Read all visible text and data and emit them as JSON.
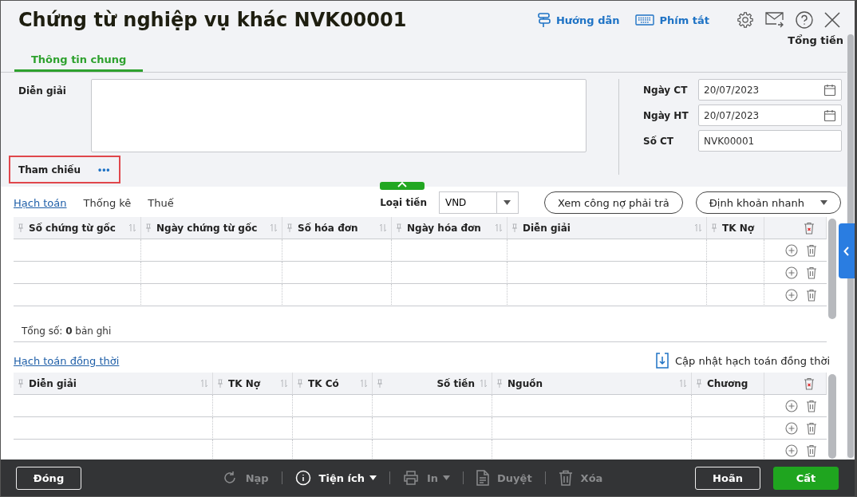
{
  "window": {
    "title": "Chứng từ nghiệp vụ khác NVK00001"
  },
  "header_links": [
    {
      "label": "Hướng dẫn"
    },
    {
      "label": "Phím tắt"
    }
  ],
  "total_label": "Tổng tiền",
  "tabs": [
    {
      "label": "Thông tin chung",
      "selected": true
    }
  ],
  "form": {
    "description_label": "Diễn giải",
    "reference_label": "Tham chiếu",
    "reference_button": "•••",
    "fields": [
      {
        "label": "Ngày CT",
        "value": "20/07/2023",
        "kind": "date"
      },
      {
        "label": "Ngày HT",
        "value": "20/07/2023",
        "kind": "date"
      },
      {
        "label": "Số CT",
        "value": "NVK00001",
        "kind": "text"
      }
    ]
  },
  "detail_tabs": [
    {
      "label": "Hạch toán",
      "selected": true
    },
    {
      "label": "Thống kê",
      "selected": false
    },
    {
      "label": "Thuế",
      "selected": false
    }
  ],
  "currency": {
    "label": "Loại tiền",
    "value": "VND"
  },
  "detail_buttons": [
    {
      "label": "Xem công nợ phải trả",
      "kind": "plain"
    },
    {
      "label": "Định khoản nhanh",
      "kind": "dropdown"
    }
  ],
  "table": {
    "columns": [
      {
        "label": "Số chứng từ gốc",
        "kind": "text"
      },
      {
        "label": "Ngày chứng từ gốc",
        "kind": "text"
      },
      {
        "label": "Số hóa đơn",
        "kind": "text"
      },
      {
        "label": "Ngày hóa đơn",
        "kind": "text"
      },
      {
        "label": "Diễn giải",
        "kind": "text"
      },
      {
        "label": "TK Nợ",
        "kind": "text"
      }
    ],
    "summary": "Tổng số: **0** bản ghi"
  },
  "concurrent": {
    "link": "Hạch toán đồng thời",
    "action": "Cập nhật hạch toán đồng thời",
    "columns": [
      {
        "label": "Diễn giải",
        "kind": "text"
      },
      {
        "label": "TK Nợ",
        "kind": "text"
      },
      {
        "label": "TK Có",
        "kind": "text"
      },
      {
        "label": "Số tiền",
        "kind": "amount"
      },
      {
        "label": "Nguồn",
        "kind": "text"
      },
      {
        "label": "Chương",
        "kind": "text"
      }
    ]
  },
  "footer": {
    "left": [
      {
        "label": "Đóng",
        "kind": "outline"
      }
    ],
    "tools": [
      {
        "label": "Nạp",
        "disabled": true,
        "menu": false
      },
      {
        "label": "Tiện ích",
        "disabled": false,
        "menu": true
      },
      {
        "label": "In",
        "disabled": true,
        "menu": true
      },
      {
        "label": "Duyệt",
        "disabled": true,
        "menu": false
      },
      {
        "label": "Xóa",
        "disabled": true,
        "menu": false
      }
    ],
    "right": [
      {
        "label": "Hoãn",
        "kind": "outline"
      },
      {
        "label": "Cất",
        "kind": "primary"
      }
    ]
  }
}
